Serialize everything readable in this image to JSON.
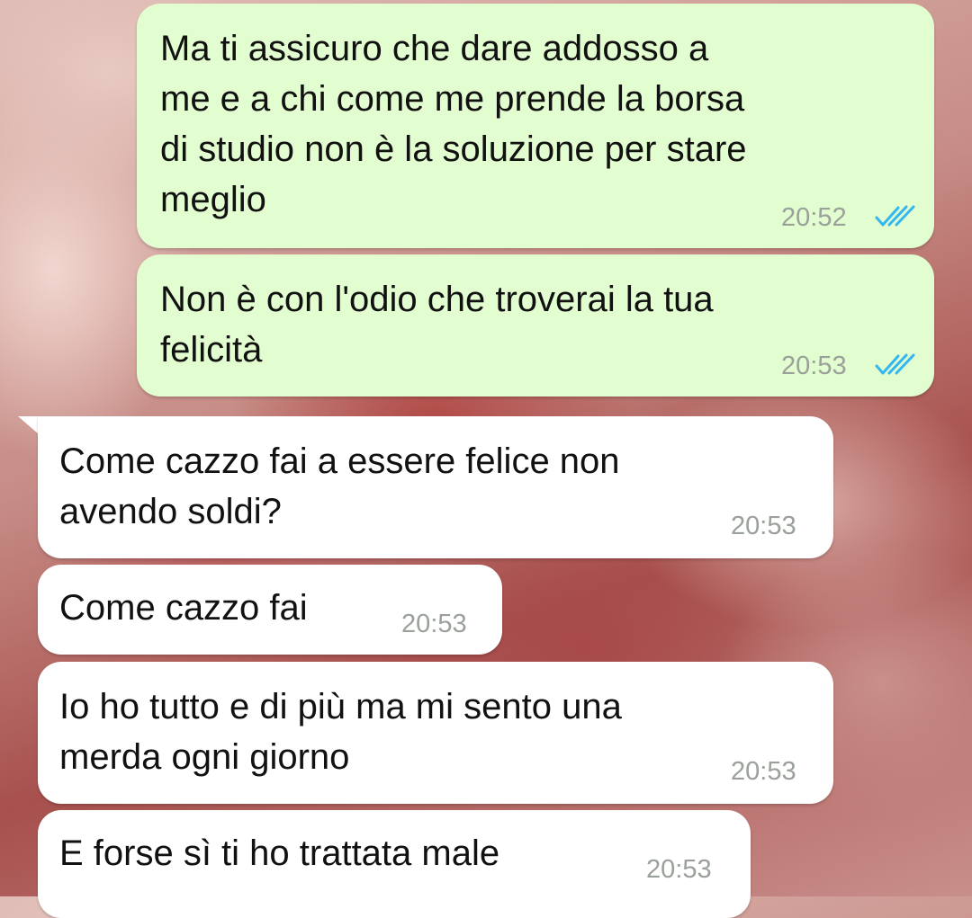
{
  "colors": {
    "outgoing_bubble": "#e2fdcf",
    "incoming_bubble": "#ffffff",
    "read_ticks": "#34b7f1",
    "timestamp": "#9aa09a"
  },
  "messages": [
    {
      "direction": "outgoing",
      "lines": [
        "Ma ti assicuro che dare addosso a",
        "me e a chi come me prende la borsa",
        "di studio non è la soluzione per stare",
        "meglio"
      ],
      "time": "20:52",
      "status_icon": "double-check-read-icon"
    },
    {
      "direction": "outgoing",
      "lines": [
        "Non è con l'odio che troverai la tua",
        "felicità"
      ],
      "time": "20:53",
      "status_icon": "double-check-read-icon"
    },
    {
      "direction": "incoming",
      "lines": [
        "Come cazzo fai a essere felice non",
        "avendo soldi?"
      ],
      "time": "20:53"
    },
    {
      "direction": "incoming",
      "lines": [
        "Come cazzo fai"
      ],
      "time": "20:53"
    },
    {
      "direction": "incoming",
      "lines": [
        "Io ho tutto e di più ma mi sento una",
        "merda ogni giorno"
      ],
      "time": "20:53"
    },
    {
      "direction": "incoming",
      "lines": [
        "E forse sì ti ho trattata male"
      ],
      "time": "20:53"
    }
  ]
}
